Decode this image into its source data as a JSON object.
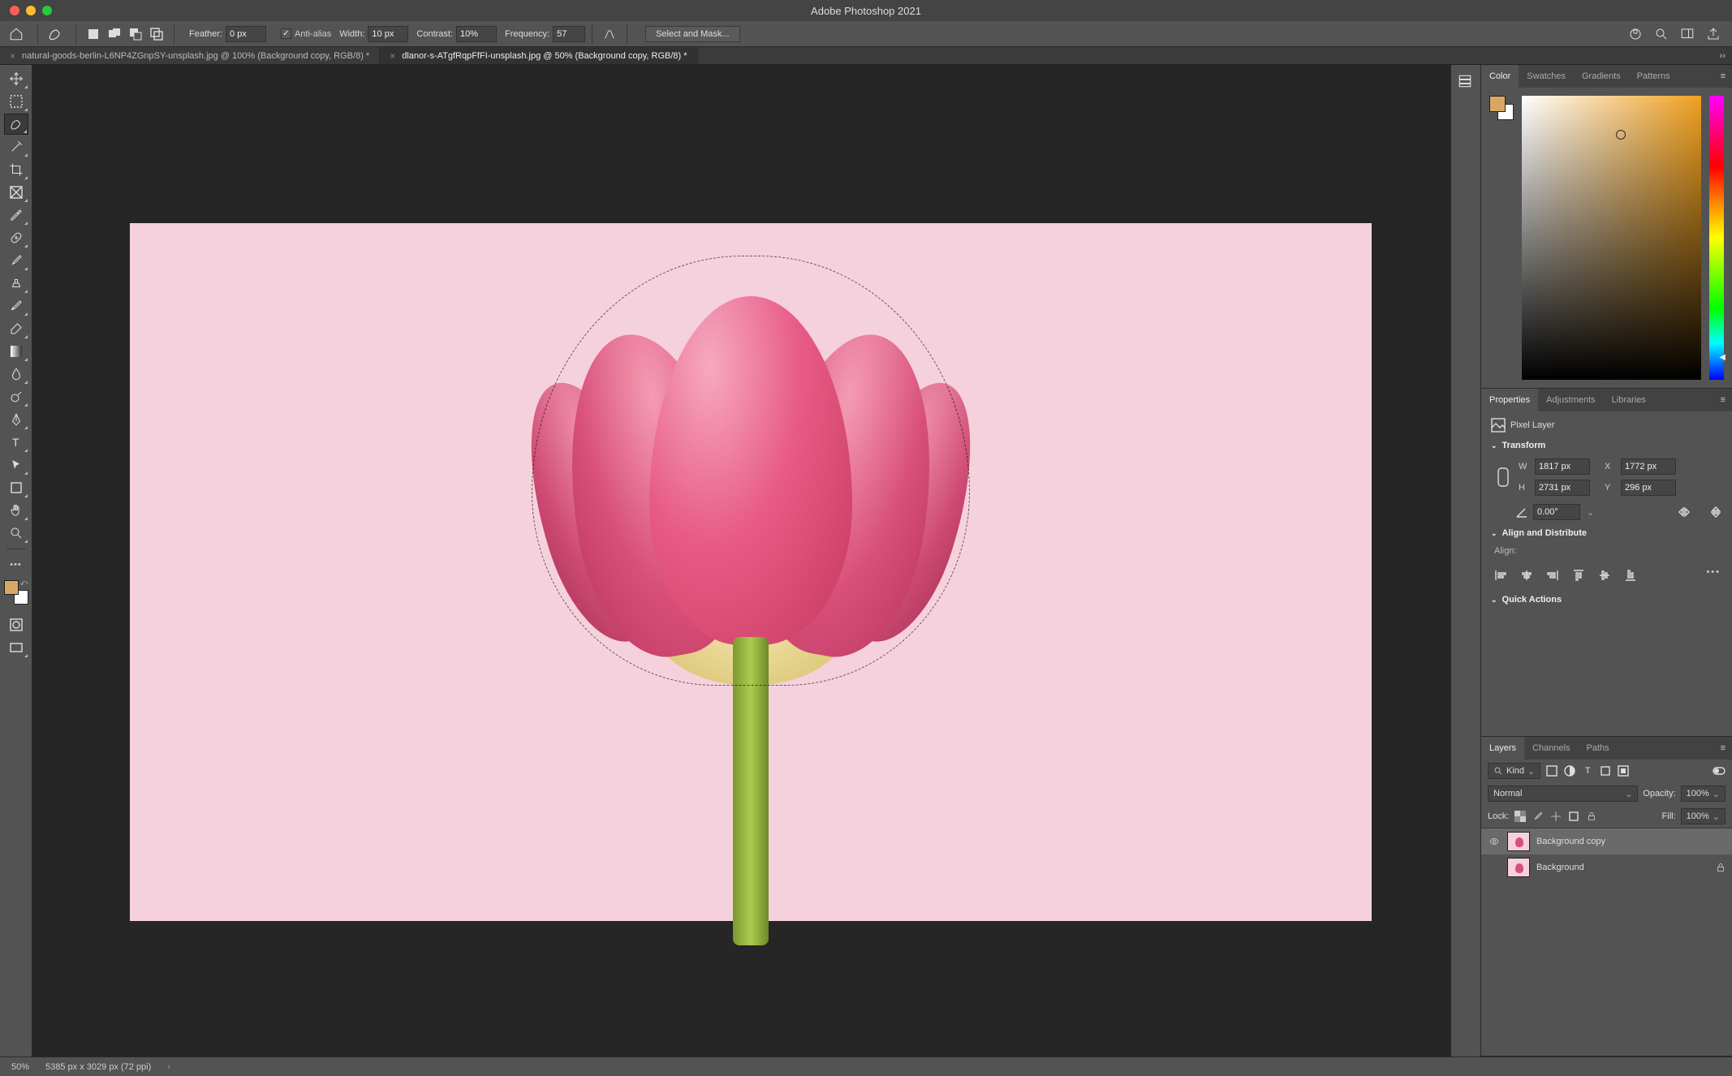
{
  "app": {
    "title": "Adobe Photoshop 2021"
  },
  "optionsBar": {
    "featherLabel": "Feather:",
    "featherValue": "0 px",
    "antiAliasLabel": "Anti-alias",
    "antiAliasChecked": true,
    "widthLabel": "Width:",
    "widthValue": "10 px",
    "contrastLabel": "Contrast:",
    "contrastValue": "10%",
    "frequencyLabel": "Frequency:",
    "frequencyValue": "57",
    "selectMaskLabel": "Select and Mask..."
  },
  "tabs": [
    {
      "label": "natural-goods-berlin-L6NP4ZGnpSY-unsplash.jpg @ 100% (Background copy, RGB/8) *",
      "active": false
    },
    {
      "label": "dlanor-s-ATgfRqpFfFI-unsplash.jpg @ 50% (Background copy, RGB/8) *",
      "active": true
    }
  ],
  "colorPanel": {
    "tabs": {
      "color": "Color",
      "swatches": "Swatches",
      "gradients": "Gradients",
      "patterns": "Patterns"
    }
  },
  "propertiesPanel": {
    "tabs": {
      "properties": "Properties",
      "adjustments": "Adjustments",
      "libraries": "Libraries"
    },
    "layerType": "Pixel Layer",
    "transform": {
      "title": "Transform",
      "W": "1817 px",
      "X": "1772 px",
      "H": "2731 px",
      "Y": "296 px",
      "angle": "0.00°"
    },
    "alignTitle": "Align and Distribute",
    "alignLabel": "Align:",
    "quickActionsTitle": "Quick Actions"
  },
  "layersPanel": {
    "tabs": {
      "layers": "Layers",
      "channels": "Channels",
      "paths": "Paths"
    },
    "filterLabel": "Kind",
    "blendMode": "Normal",
    "opacityLabel": "Opacity:",
    "opacityValue": "100%",
    "lockLabel": "Lock:",
    "fillLabel": "Fill:",
    "fillValue": "100%",
    "layers": [
      {
        "name": "Background copy",
        "visible": true,
        "selected": true,
        "locked": false
      },
      {
        "name": "Background",
        "visible": false,
        "selected": false,
        "locked": true
      }
    ]
  },
  "statusBar": {
    "zoom": "50%",
    "docInfo": "5385 px x 3029 px (72 ppi)"
  }
}
